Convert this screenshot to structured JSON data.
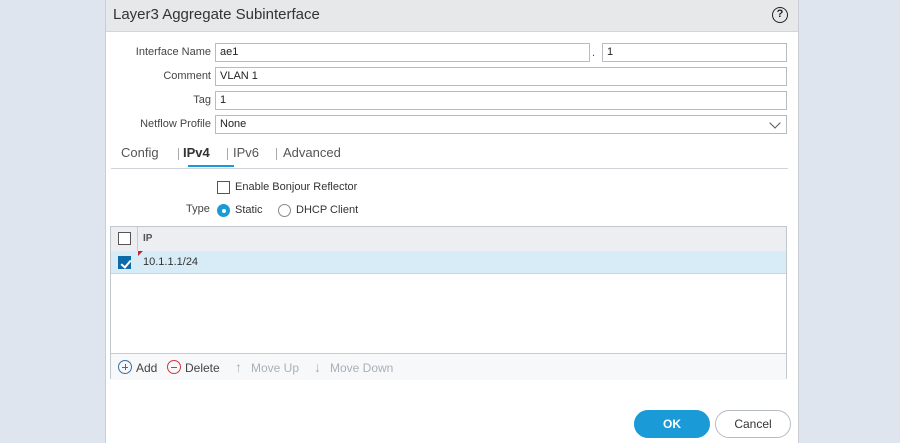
{
  "dialog": {
    "title": "Layer3 Aggregate Subinterface",
    "help_icon": "?"
  },
  "form": {
    "interface_name": {
      "label": "Interface Name",
      "value": "ae1",
      "separator": ".",
      "suffix": "1"
    },
    "comment": {
      "label": "Comment",
      "value": "VLAN 1"
    },
    "tag": {
      "label": "Tag",
      "value": "1"
    },
    "netflow_profile": {
      "label": "Netflow Profile",
      "value": "None"
    }
  },
  "tabs": [
    {
      "label": "Config"
    },
    {
      "label": "IPv4"
    },
    {
      "label": "IPv6"
    },
    {
      "label": "Advanced"
    }
  ],
  "active_tab": "IPv4",
  "ipv4": {
    "bonjour": {
      "label": "Enable Bonjour Reflector",
      "checked": false
    },
    "type": {
      "label": "Type",
      "options": [
        {
          "label": "Static",
          "selected": true
        },
        {
          "label": "DHCP Client",
          "selected": false
        }
      ]
    },
    "table": {
      "header": "IP",
      "rows": [
        {
          "ip": "10.1.1.1/24",
          "checked": true
        }
      ]
    },
    "toolbar": {
      "add": "Add",
      "delete": "Delete",
      "move_up": "Move Up",
      "move_down": "Move Down"
    }
  },
  "buttons": {
    "ok": "OK",
    "cancel": "Cancel"
  },
  "colors": {
    "accent": "#1a9bd7",
    "checkbox_checked": "#0d6aa8",
    "delete": "#d0373d",
    "add": "#3a6fa5"
  }
}
